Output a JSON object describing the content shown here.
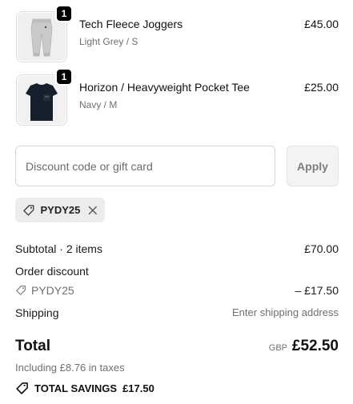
{
  "items": [
    {
      "name": "Tech Fleece Joggers",
      "variant": "Light Grey / S",
      "price": "£45.00",
      "quantity": "1",
      "image_icon": "joggers-image"
    },
    {
      "name": "Horizon / Heavyweight Pocket Tee",
      "variant": "Navy / M",
      "price": "£25.00",
      "quantity": "1",
      "image_icon": "tee-image"
    }
  ],
  "discount": {
    "placeholder": "Discount code or gift card",
    "apply_label": "Apply",
    "applied_code": "PYDY25"
  },
  "summary": {
    "subtotal_label": "Subtotal · 2 items",
    "subtotal_value": "£70.00",
    "order_discount_label": "Order discount",
    "discount_code": "PYDY25",
    "discount_value": "– £17.50",
    "shipping_label": "Shipping",
    "shipping_value": "Enter shipping address"
  },
  "total": {
    "label": "Total",
    "currency": "GBP",
    "amount": "£52.50",
    "tax_note": "Including £8.76 in taxes",
    "savings_label": "TOTAL SAVINGS",
    "savings_value": "£17.50"
  },
  "colors": {
    "badge": "#000000",
    "chip_bg": "#ececec",
    "apply_bg": "#f3f3f3",
    "muted_text": "#707070"
  }
}
